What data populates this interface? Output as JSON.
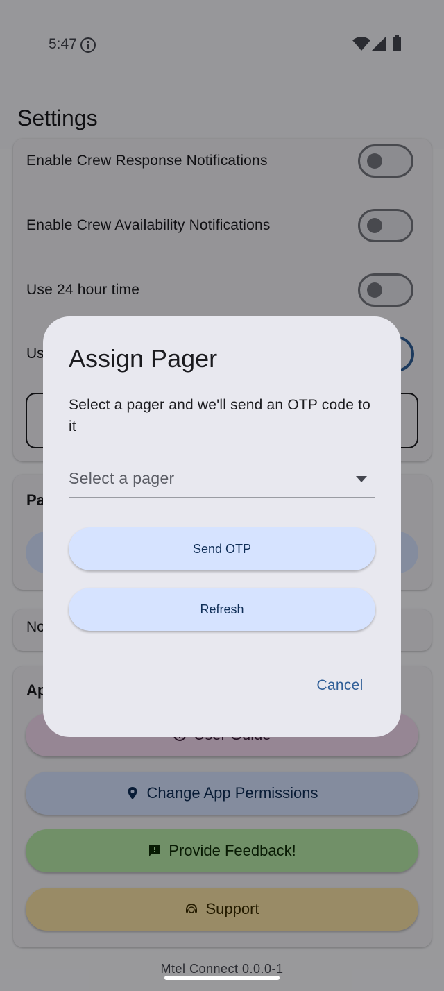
{
  "status_bar": {
    "time": "5:47"
  },
  "app_bar": {
    "title": "Settings"
  },
  "settings": [
    {
      "label": "Enable Crew Response Notifications"
    },
    {
      "label": "Enable Crew Availability Notifications"
    },
    {
      "label": "Use 24 hour time"
    }
  ],
  "settings_partial_label": "Us",
  "pager_section": {
    "heading_partial": "Pa"
  },
  "notif_section": {
    "text_partial": "No"
  },
  "app_section": {
    "heading_partial": "Ap"
  },
  "app_buttons": {
    "user_guide": "User Guide",
    "change_permissions": "Change App Permissions",
    "provide_feedback": "Provide Feedback!",
    "support": "Support"
  },
  "footer": {
    "version": "Mtel Connect 0.0.0-1"
  },
  "dialog": {
    "title": "Assign Pager",
    "body": "Select a pager and we'll send an OTP code to it",
    "select_placeholder": "Select a pager",
    "send_otp_label": "Send OTP",
    "refresh_label": "Refresh",
    "cancel_label": "Cancel"
  },
  "colors": {
    "accent": "#2f5e97",
    "tonal_button": "#d6e3ff",
    "dialog_surface": "#e8e8ef",
    "feedback_button": "#b6e8a8",
    "support_button": "#f7e1a5",
    "guide_button": "#f2d9ef"
  }
}
